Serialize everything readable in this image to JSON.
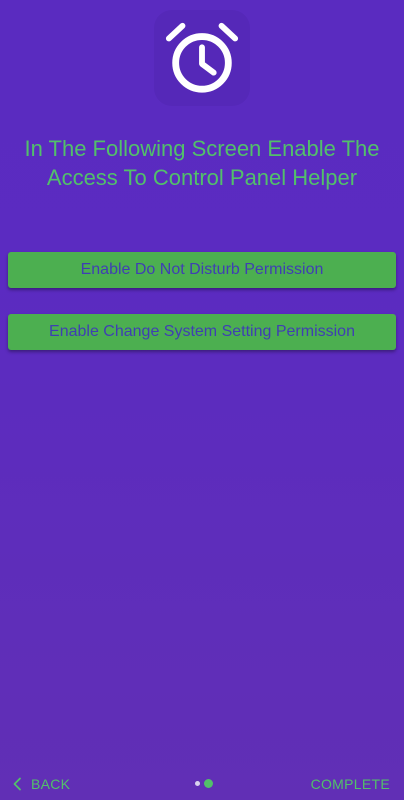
{
  "header": {
    "icon": "alarm-clock-icon",
    "title": "In The Following Screen Enable The Access To Control Panel Helper"
  },
  "buttons": {
    "do_not_disturb": "Enable Do Not Disturb Permission",
    "system_setting": "Enable Change System Setting Permission"
  },
  "navigation": {
    "back_label": "BACK",
    "back_icon": "chevron-left-icon",
    "complete_label": "COMPLETE",
    "page_count": 2,
    "current_page": 2
  },
  "colors": {
    "background": "#5b2bc1",
    "accent_green": "#52c06a",
    "button_green": "#4caf50",
    "button_text": "#3f3fb3"
  }
}
